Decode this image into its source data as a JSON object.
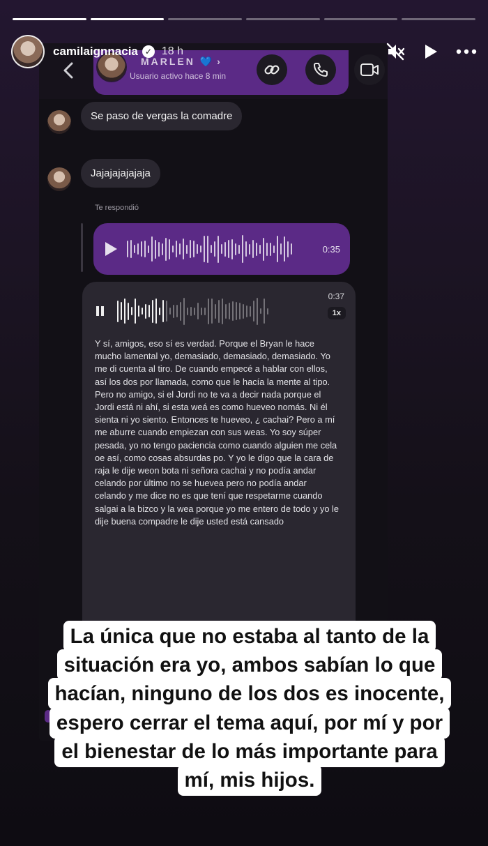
{
  "story": {
    "progress": [
      1,
      1,
      0,
      0,
      0,
      0
    ],
    "account": {
      "username": "camilaignnacia",
      "time_ago": "18 h"
    },
    "header_icons": [
      "mute-icon",
      "play-icon",
      "more-icon"
    ]
  },
  "dm": {
    "contact_name": "MARLEN",
    "contact_heart": "💙",
    "chevron": "›",
    "status": "Usuario activo hace 8 min",
    "messages": [
      {
        "text": "Se paso de vergas la comadre",
        "reaction": "❤️"
      },
      {
        "text": "Jajajajajajaja"
      }
    ],
    "replied_label": "Te respondió",
    "voice_reply": {
      "duration": "0:35"
    },
    "voice_transcribed": {
      "duration": "0:37",
      "speed": "1x",
      "transcript": "Y sí, amigos, eso sí es verdad. Porque el Bryan le hace mucho lamental yo, demasiado, demasiado, demasiado. Yo me di cuenta al tiro. De cuando empecé a hablar con ellos, así los dos por llamada, como que le hacía la mente al tipo. Pero no amigo, si el Jordi no te va a decir nada porque el Jordi está ni ahí, si esta weá es como hueveo nomás. Ni él sienta ni yo siento. Entonces te hueveo, ¿ cachai? Pero a mí me aburre cuando empiezan con sus weas. Yo soy súper pesada, yo no tengo paciencia como cuando alguien me cela oe así, como cosas absurdas po. Y yo le digo que la cara de raja le dije weon bota ni señora cachai y no podía andar celando por último no se huevea pero no podía andar celando y me dice no es que tení que respetarme cuando salgai a la bizco y la wea porque yo me entero de todo y yo le dije buena compadre le dije usted está cansado"
    }
  },
  "caption": "La única que no estaba al tanto de la situación era yo, ambos sabían lo que hacían, ninguno de los dos es inocente, espero cerrar el tema aquí, por mí y por el bienestar de lo más importante para mí, mis hijos."
}
